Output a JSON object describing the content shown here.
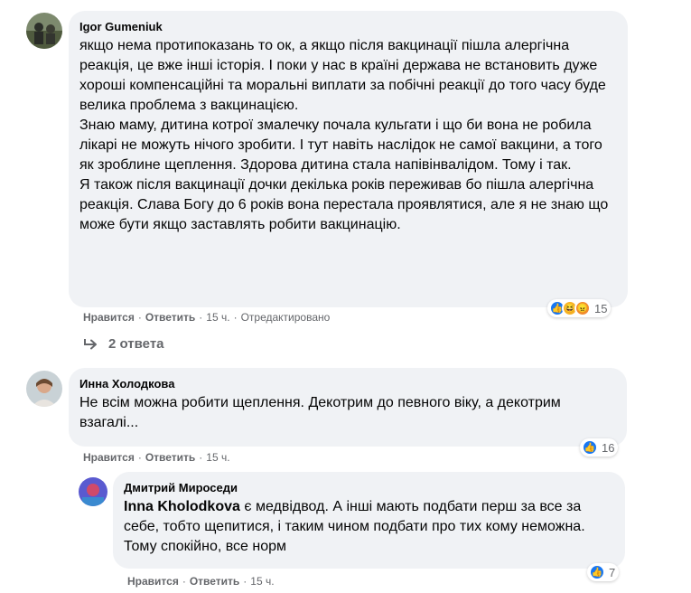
{
  "comments": [
    {
      "author": "Igor Gumeniuk",
      "text": "якщо нема протипоказань то ок, а якщо після вакцинації пішла алергічна реакція, це вже інші історія. І поки у нас в країні держава не встановить дуже хороші компенсаційні та моральні виплати за побічні реакції до того часу буде велика проблема з вакцинацією.\nЗнаю маму, дитина котрої змалечку почала кульгати і що би вона не робила лікарі не можуть нічого зробити. І тут навіть наслідок не самої вакцини, а того як зроблине щеплення. Здорова дитина стала напівінвалідом. Тому і так.\nЯ також після вакцинації дочки декілька років переживав бо пішла алергічна реакція. Слава Богу до 6 років вона перестала проявлятися, але я не знаю що може бути якщо заставлять робити вакцинацію.",
      "like_label": "Нравится",
      "reply_label": "Ответить",
      "time": "15 ч.",
      "edited": "Отредактировано",
      "reaction_count": "15",
      "replies_label": "2 ответа"
    },
    {
      "author": "Инна Холодкова",
      "text": "Не всім можна робити щеплення. Декотрим до певного віку, а декотрим взагалі...",
      "like_label": "Нравится",
      "reply_label": "Ответить",
      "time": "15 ч.",
      "reaction_count": "16"
    },
    {
      "author": "Дмитрий Мироседи",
      "mention": "Inna Kholodkova",
      "text": " є медвідвод. А інші мають подбати перш за все за себе, тобто щепитися, і таким чином подбати про тих кому неможна. Тому спокійно, все норм",
      "like_label": "Нравится",
      "reply_label": "Ответить",
      "time": "15 ч.",
      "reaction_count": "7"
    }
  ],
  "colors": {
    "bubble": "#f0f2f5",
    "meta": "#65676b",
    "like_blue": "#1877f2"
  }
}
